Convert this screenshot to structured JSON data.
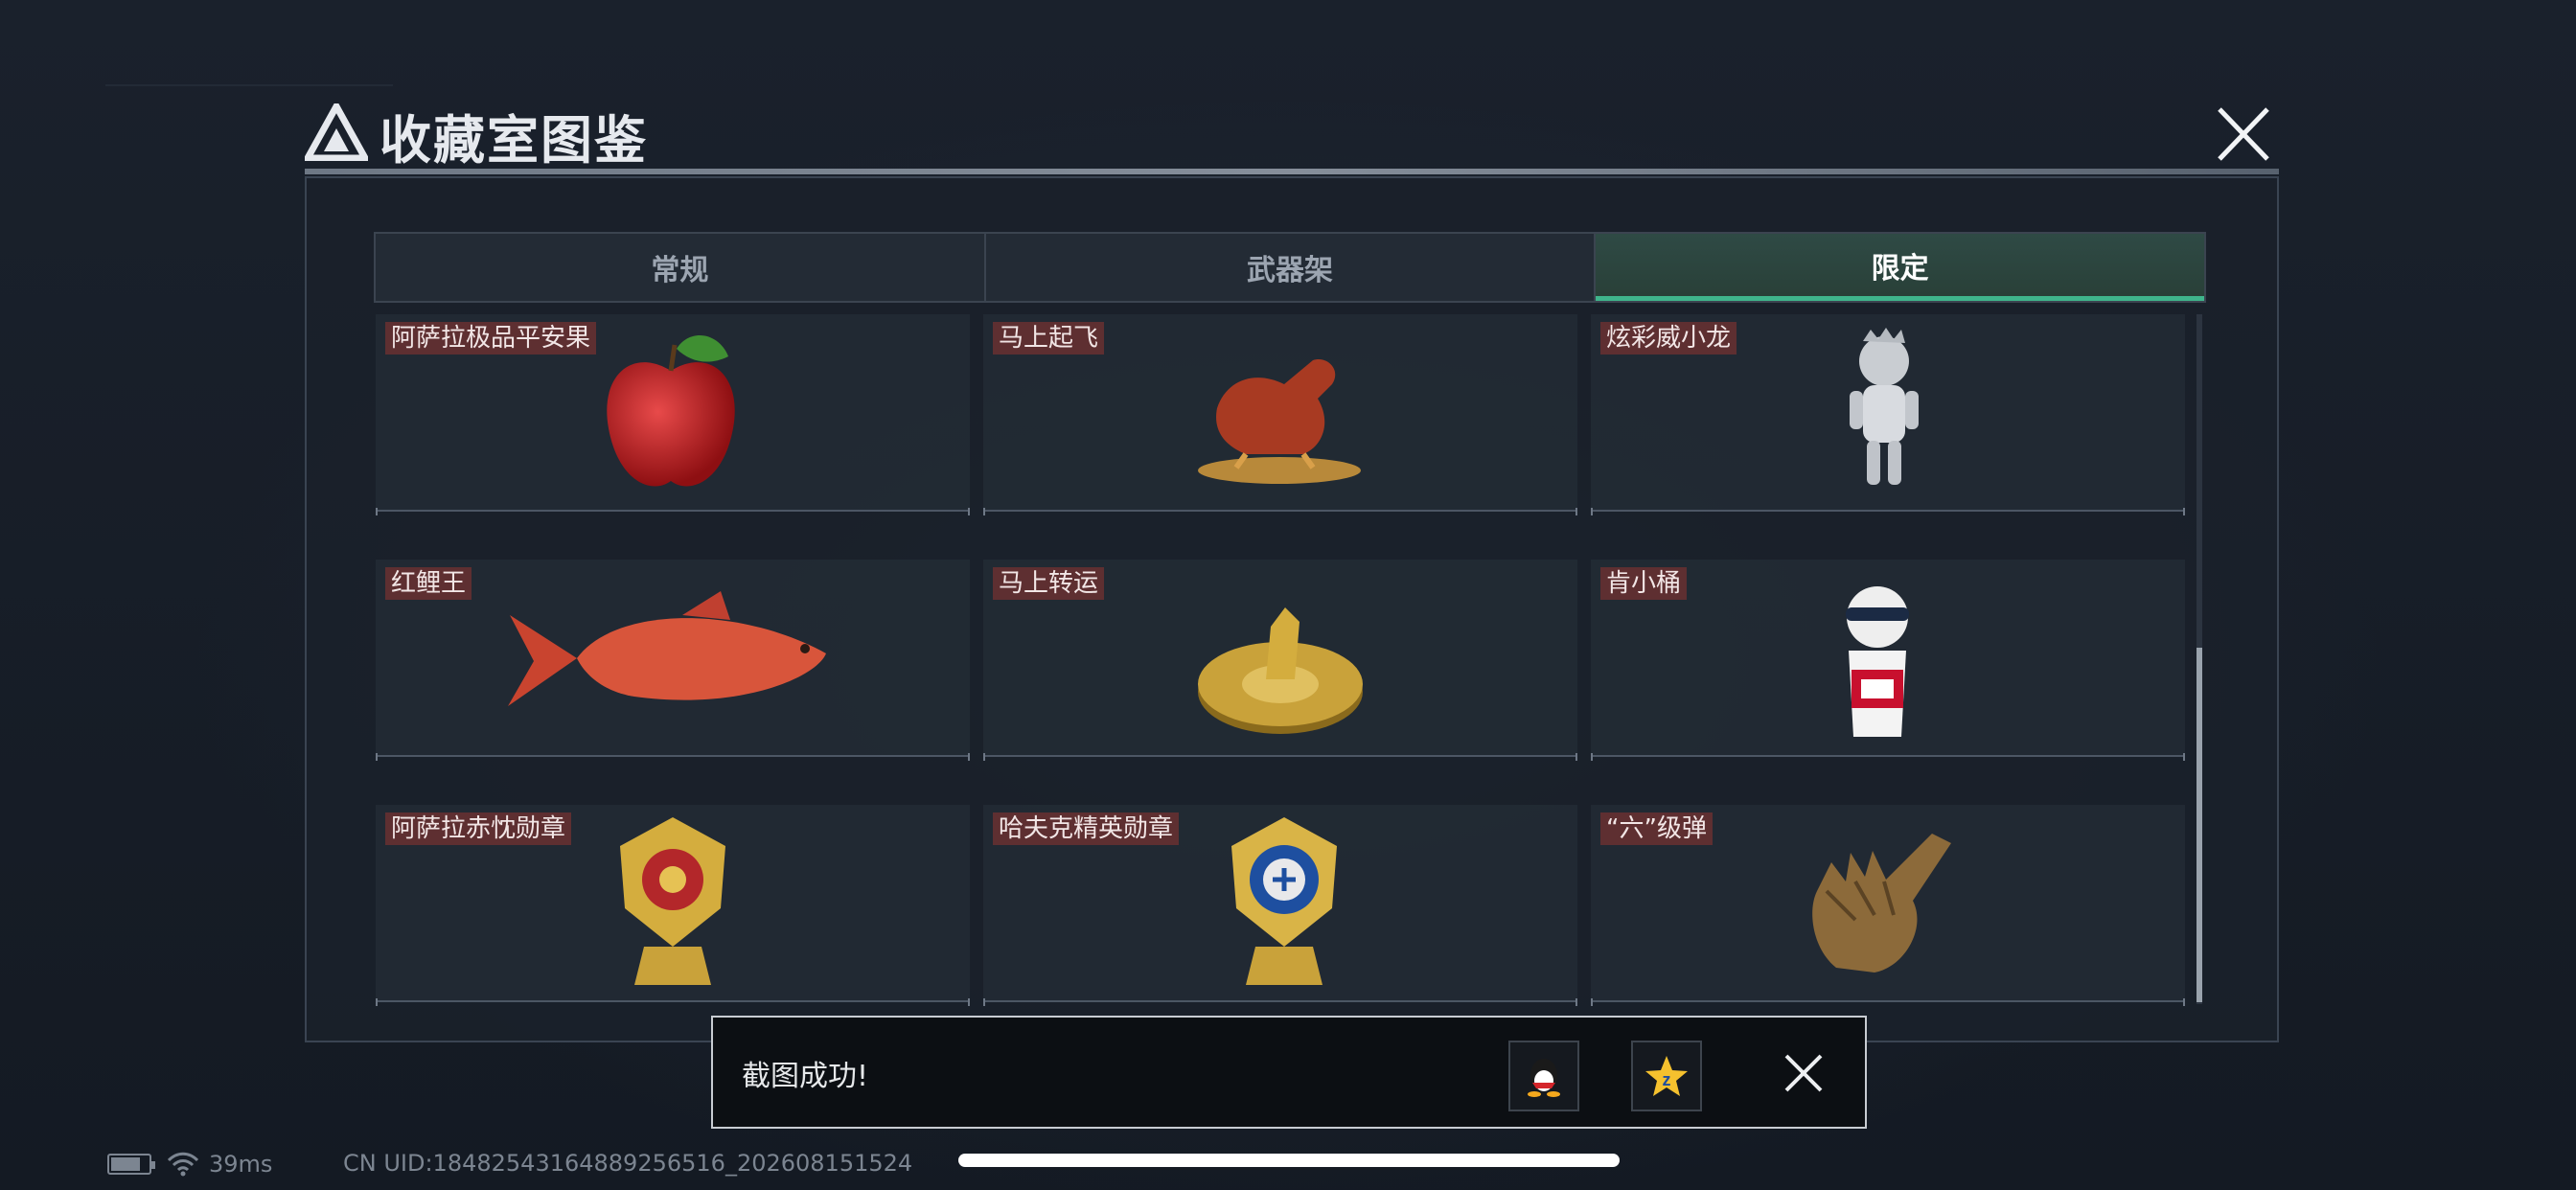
{
  "dialog": {
    "title": "收藏室图鉴"
  },
  "tabs": [
    {
      "label": "常规",
      "active": false
    },
    {
      "label": "武器架",
      "active": false
    },
    {
      "label": "限定",
      "active": true
    }
  ],
  "items": [
    {
      "label": "阿萨拉极品平安果",
      "icon": "red-apple-icon"
    },
    {
      "label": "马上起飞",
      "icon": "bronze-horse-icon"
    },
    {
      "label": "炫彩威小龙",
      "icon": "silver-dragon-figure-icon"
    },
    {
      "label": "红鲤王",
      "icon": "red-carp-icon"
    },
    {
      "label": "马上转运",
      "icon": "golden-horse-wheel-icon"
    },
    {
      "label": "肯小桶",
      "icon": "kfc-mascot-figure-icon"
    },
    {
      "label": "阿萨拉赤忱勋章",
      "icon": "red-gold-medal-icon"
    },
    {
      "label": "哈夫克精英勋章",
      "icon": "blue-gold-medal-icon"
    },
    {
      "label": "“六”级弹",
      "icon": "bronze-hand-gesture-icon"
    }
  ],
  "toast": {
    "message": "截图成功!",
    "share_qq_icon": "qq-penguin-icon",
    "share_qzone_icon": "qzone-star-icon"
  },
  "status": {
    "ping": "39ms",
    "uid": "CN UID:18482543164889256516_202608151524",
    "battery_level": 0.8
  },
  "colors": {
    "accent": "#3fb58c",
    "label_bg": "#5e2f31"
  }
}
